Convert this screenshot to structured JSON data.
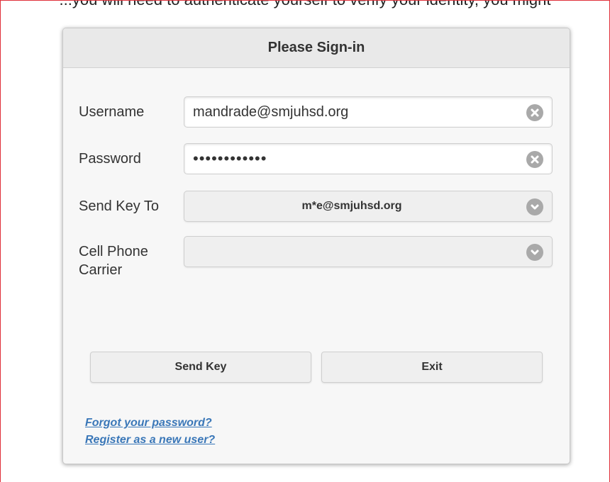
{
  "header_fragment": "...you will need to authenticate yourself to verify your identity, you might",
  "dialog": {
    "title": "Please Sign-in"
  },
  "form": {
    "username": {
      "label": "Username",
      "value": "mandrade@smjuhsd.org",
      "clear_icon": "clear-x-icon"
    },
    "password": {
      "label": "Password",
      "value": "••••••••••••",
      "clear_icon": "clear-x-icon"
    },
    "send_key_to": {
      "label": "Send Key To",
      "selected": "m*e@smjuhsd.org",
      "dropdown_icon": "chevron-down-icon"
    },
    "cell_phone_carrier": {
      "label": "Cell Phone Carrier",
      "selected": "",
      "dropdown_icon": "chevron-down-icon"
    }
  },
  "buttons": {
    "send_key": "Send Key",
    "exit": "Exit"
  },
  "links": {
    "forgot_password": "Forgot your password?",
    "register": "Register as a new user?"
  },
  "colors": {
    "link": "#3a77b8",
    "page_border": "#e0303a",
    "icon_gray": "#a9a9a9"
  }
}
